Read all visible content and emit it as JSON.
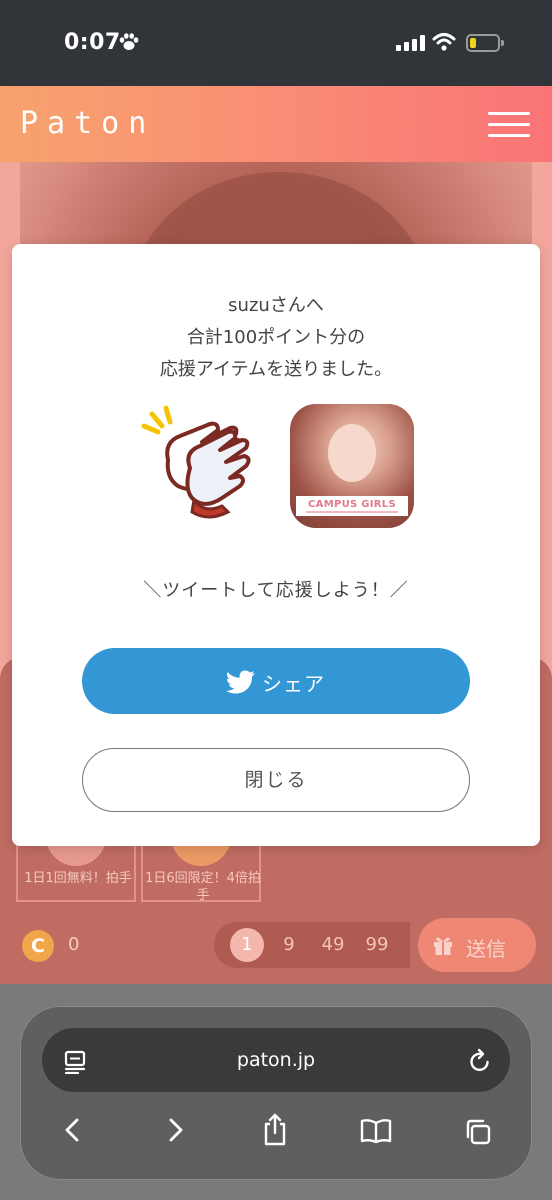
{
  "status_bar": {
    "time": "0:07",
    "battery_color": "#f0d21e"
  },
  "header": {
    "logo": "Paton",
    "menu_icon": "hamburger-menu-icon",
    "gradient": [
      "#f7a36d",
      "#f97476"
    ]
  },
  "modal": {
    "message_lines": [
      "suzuさんへ",
      "合計100ポイント分の",
      "応援アイテムを送りました。"
    ],
    "photo_banner": "CAMPUS GIRLS",
    "tweet_prompt": "＼ツイートして応援しよう！／",
    "share_label": "シェア",
    "share_color": "#3497d5",
    "close_label": "閉じる"
  },
  "background": {
    "cards": [
      "1日1回無料！拍手",
      "1日6回限定！4倍拍手"
    ],
    "coin_symbol": "C",
    "coin_count": "0",
    "amounts": [
      "1",
      "9",
      "49",
      "99"
    ],
    "selected_amount": "1",
    "send_label": "送信"
  },
  "browser": {
    "url": "paton.jp"
  }
}
